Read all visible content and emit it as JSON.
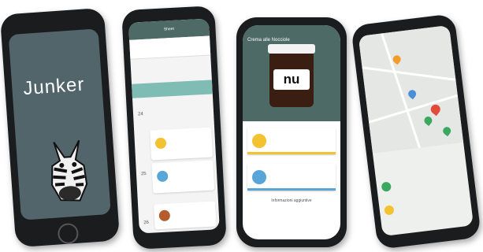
{
  "phones": {
    "p1": {
      "logo": "Junker"
    },
    "p2": {
      "title": "Sheet",
      "dates": [
        {
          "num": "24",
          "items": []
        },
        {
          "num": "25",
          "items": []
        },
        {
          "num": "26",
          "items": []
        }
      ],
      "item_colors": [
        "#f2c230",
        "#58a6d8",
        "#b55c2e"
      ]
    },
    "p3": {
      "title": "Crema alle Nocciole",
      "jar_label": "nu",
      "section_title": "Informazioni aggiuntive",
      "cards": [
        {
          "color": "#f2c230",
          "bar": "#f2c230"
        },
        {
          "color": "#58a6d8",
          "bar": "#58a6d8"
        }
      ]
    },
    "p4": {
      "pins": [
        "#e24b3a",
        "#f29c2a",
        "#3aa860",
        "#4b8fd8",
        "#e24b3a",
        "#3aa860"
      ]
    }
  },
  "colors": {
    "body": "#1b1c1e",
    "teal": "#4d6a67",
    "screen1": "#52656a"
  }
}
